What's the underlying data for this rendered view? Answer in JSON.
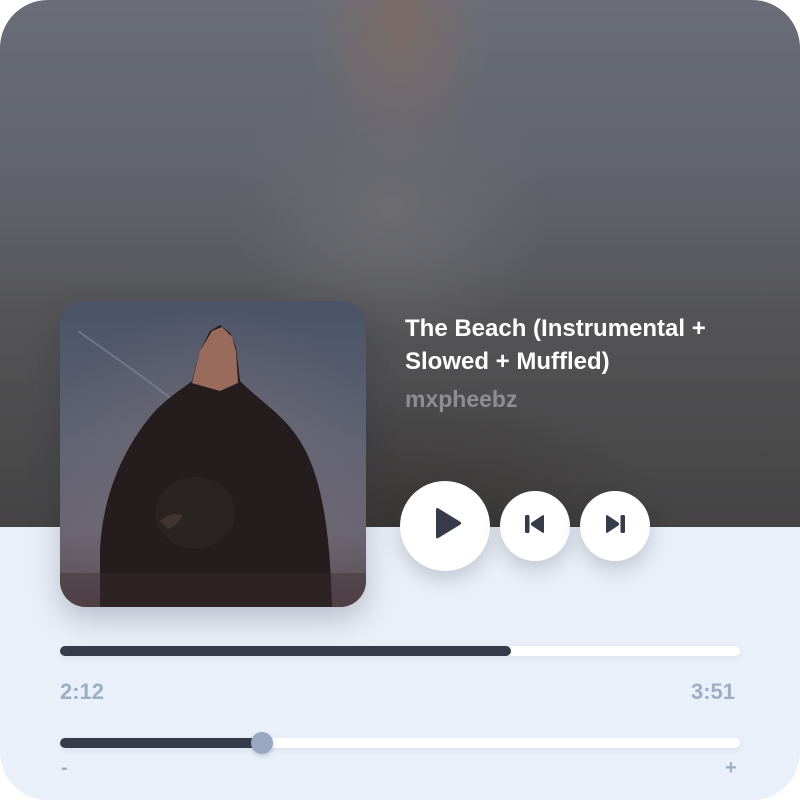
{
  "track": {
    "title": "The Beach (Instrumental + Slowed + Muffled)",
    "artist": "mxpheebz"
  },
  "controls": {
    "play_icon": "play-icon",
    "previous_icon": "skip-previous-icon",
    "next_icon": "skip-next-icon"
  },
  "progress": {
    "elapsed": "2:12",
    "total": "3:51",
    "fraction": 0.663
  },
  "volume": {
    "minus_label": "-",
    "plus_label": "+",
    "fraction": 0.297
  },
  "colors": {
    "accent_dark": "#353b48",
    "accent_light": "#9eadc6",
    "panel_background": "#eaf0f9"
  }
}
